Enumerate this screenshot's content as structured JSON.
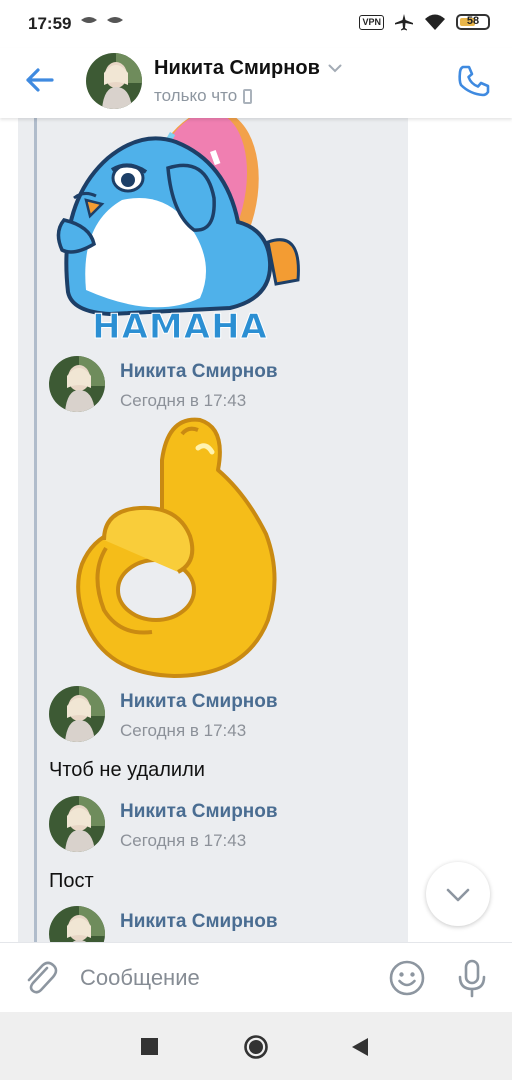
{
  "status_bar": {
    "time": "17:59",
    "vpn_label": "VPN",
    "battery": "58",
    "battery_level": 0.58
  },
  "header": {
    "contact_name": "Никита Смирнов",
    "status": "только что"
  },
  "stickers": {
    "penguin_caption": "НАМАНА"
  },
  "messages": [
    {
      "author": "Никита Смирнов",
      "time": "Сегодня в 17:43",
      "text": ""
    },
    {
      "author": "Никита Смирнов",
      "time": "Сегодня в 17:43",
      "text": "Чтоб не удалили"
    },
    {
      "author": "Никита Смирнов",
      "time": "Сегодня в 17:43",
      "text": "Пост"
    },
    {
      "author": "Никита Смирнов",
      "time": "",
      "text": ""
    }
  ],
  "compose": {
    "placeholder": "Сообщение"
  },
  "colors": {
    "accent": "#3f8ae0",
    "author": "#4a6d92",
    "forward_bg": "#ebedf0",
    "forward_line": "#b0bccb"
  }
}
